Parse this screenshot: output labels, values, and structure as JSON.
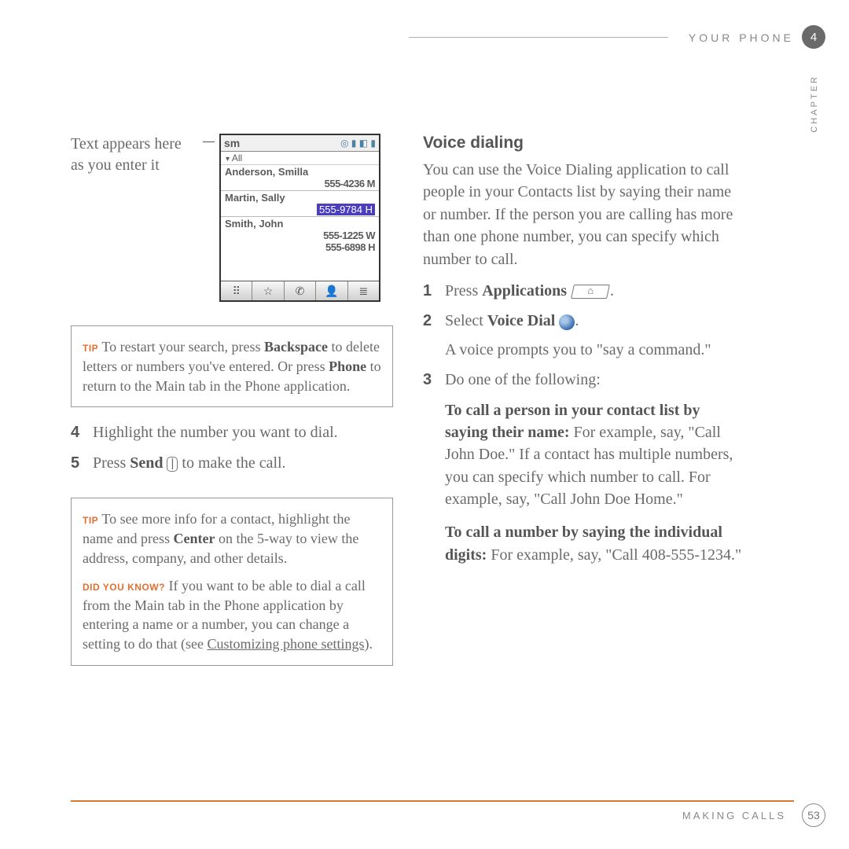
{
  "header": {
    "section": "YOUR PHONE",
    "chapter_num": "4",
    "chapter_label": "CHAPTER"
  },
  "left": {
    "callout": "Text appears here as you enter it",
    "screenshot": {
      "search_text": "sm",
      "filter": "All",
      "contacts": [
        {
          "name": "Anderson, Smilla",
          "numbers": [
            "555-4236 M"
          ],
          "highlight": false
        },
        {
          "name": "Martin, Sally",
          "numbers": [
            "555-9784 H"
          ],
          "highlight": true
        },
        {
          "name": "Smith, John",
          "numbers": [
            "555-1225 W",
            "555-6898 H"
          ],
          "highlight": false
        }
      ],
      "tabs": [
        "⠿",
        "☆",
        "✆",
        "👤",
        "≣"
      ]
    },
    "tip1": {
      "label": "TIP",
      "t1": "To restart your search, press ",
      "b1": "Backspace",
      "t2": " to delete letters or numbers you've entered. Or press ",
      "b2": "Phone",
      "t3": " to return to the Main tab in the Phone application."
    },
    "step4": {
      "num": "4",
      "text": "Highlight the number you want to dial."
    },
    "step5": {
      "num": "5",
      "t1": "Press ",
      "b1": "Send",
      "key": "|",
      "t2": " to make the call."
    },
    "tip2": {
      "label": "TIP",
      "t1": "To see more info for a contact, highlight the name and press ",
      "b1": "Center",
      "t2": " on the 5-way to view the address, company, and other details."
    },
    "dyk": {
      "label": "DID YOU KNOW?",
      "t1": "If you want to be able to dial a call from the Main tab in the Phone application by entering a name or a number, you can change a setting to do that (see ",
      "link": "Customizing phone settings",
      "t2": ")."
    }
  },
  "right": {
    "heading": "Voice dialing",
    "intro": "You can use the Voice Dialing application to call people in your Contacts list by saying their name or number. If the person you are calling has more than one phone number, you can specify which number to call.",
    "step1": {
      "num": "1",
      "t1": "Press ",
      "b1": "Applications",
      "t2": "."
    },
    "step2": {
      "num": "2",
      "t1": "Select ",
      "b1": "Voice Dial",
      "t2": ".",
      "prompt": "A voice prompts you to \"say a command.\""
    },
    "step3": {
      "num": "3",
      "text": "Do one of the following:"
    },
    "blockA": {
      "b1": "To call a person in your contact list by saying their name:",
      "t1": " For example, say, \"Call John Doe.\" If a contact has multiple numbers, you can specify which number to call. For example, say, \"Call John Doe Home.\""
    },
    "blockB": {
      "b1": "To call a number by saying the individual digits:",
      "t1": " For example, say, \"Call 408-555-1234.\""
    }
  },
  "footer": {
    "section": "MAKING CALLS",
    "page": "53"
  }
}
